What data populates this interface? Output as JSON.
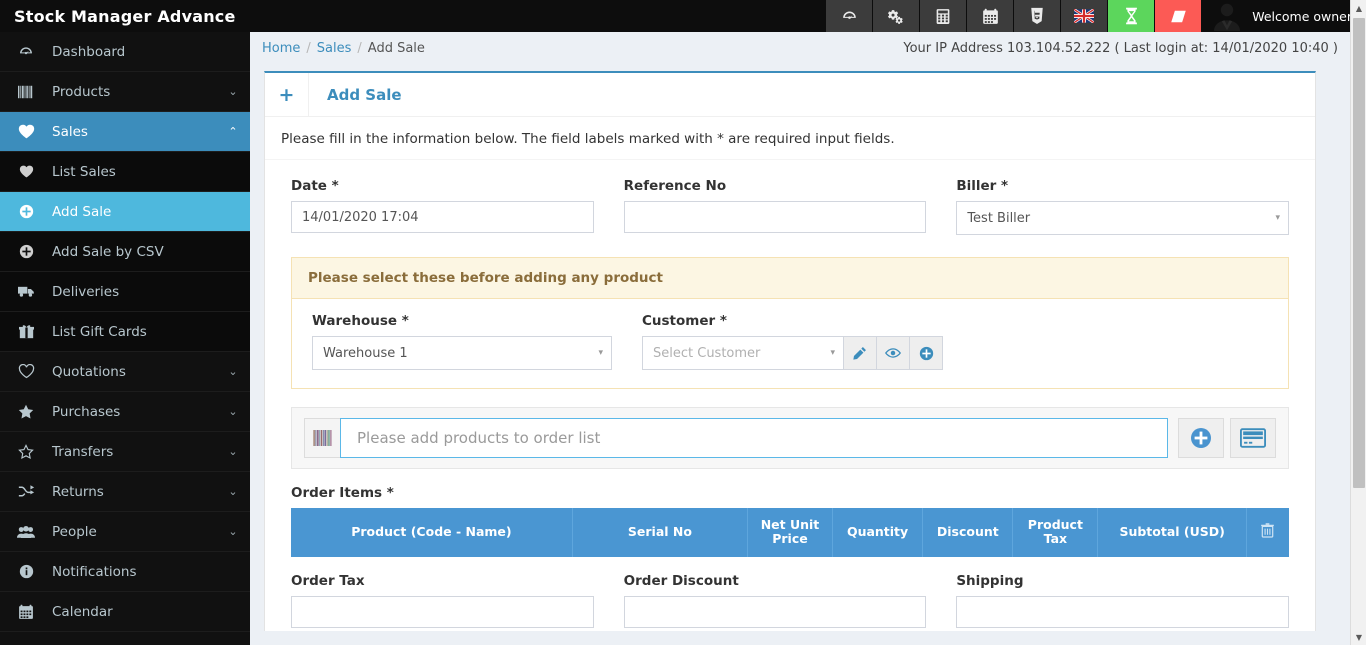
{
  "app": {
    "brand": "Stock Manager Advance",
    "user_greeting": "Welcome owner"
  },
  "topbar": {
    "icons": [
      {
        "name": "dashboard-icon",
        "glyph": "⚙",
        "style": "dark"
      },
      {
        "name": "settings-gears-icon",
        "glyph": "⚙",
        "style": "dark"
      },
      {
        "name": "calculator-icon",
        "glyph": "὚9",
        "style": "dark"
      },
      {
        "name": "calendar-icon",
        "glyph": "Ὄ5",
        "style": "dark"
      },
      {
        "name": "css3-icon",
        "glyph": "Ⓒ",
        "style": "dark"
      },
      {
        "name": "language-flag-icon",
        "glyph": "἞C",
        "style": "dark"
      },
      {
        "name": "hourglass-icon",
        "glyph": "⌛",
        "style": "green"
      },
      {
        "name": "eraser-icon",
        "glyph": "▱",
        "style": "red"
      }
    ],
    "colors": {
      "green": "#5cd65c",
      "red": "#fc5a55",
      "dark": "#3c3c3c"
    }
  },
  "sidebar": {
    "items": [
      {
        "label": "Dashboard",
        "icon": "dashboard-icon",
        "caret": "",
        "state": ""
      },
      {
        "label": "Products",
        "icon": "barcode-icon",
        "caret": "⌄",
        "state": ""
      },
      {
        "label": "Sales",
        "icon": "heart-filled-icon",
        "caret": "⌃",
        "state": "active-parent"
      },
      {
        "label": "List Sales",
        "icon": "heart-filled-icon",
        "caret": "",
        "state": "sub"
      },
      {
        "label": "Add Sale",
        "icon": "plus-circle-icon",
        "caret": "",
        "state": "active-child"
      },
      {
        "label": "Add Sale by CSV",
        "icon": "plus-circle-icon",
        "caret": "",
        "state": "sub"
      },
      {
        "label": "Deliveries",
        "icon": "truck-icon",
        "caret": "",
        "state": "sub"
      },
      {
        "label": "List Gift Cards",
        "icon": "gift-icon",
        "caret": "",
        "state": "sub"
      },
      {
        "label": "Quotations",
        "icon": "heart-outline-icon",
        "caret": "⌄",
        "state": ""
      },
      {
        "label": "Purchases",
        "icon": "star-filled-icon",
        "caret": "⌄",
        "state": ""
      },
      {
        "label": "Transfers",
        "icon": "star-outline-icon",
        "caret": "⌄",
        "state": ""
      },
      {
        "label": "Returns",
        "icon": "shuffle-icon",
        "caret": "⌄",
        "state": ""
      },
      {
        "label": "People",
        "icon": "users-icon",
        "caret": "⌄",
        "state": ""
      },
      {
        "label": "Notifications",
        "icon": "info-circle-icon",
        "caret": "",
        "state": ""
      },
      {
        "label": "Calendar",
        "icon": "calendar-icon",
        "caret": "",
        "state": ""
      }
    ]
  },
  "breadcrumb": {
    "home": "Home",
    "section": "Sales",
    "current": "Add Sale",
    "separator": "/"
  },
  "ip_info": "Your IP Address 103.104.52.222 ( Last login at: 14/01/2020 10:40 )",
  "panel": {
    "plus": "+",
    "title": "Add Sale",
    "subtitle": "Please fill in the information below. The field labels marked with * are required input fields."
  },
  "form": {
    "date": {
      "label": "Date *",
      "value": "14/01/2020 17:04"
    },
    "reference_no": {
      "label": "Reference No",
      "value": "",
      "placeholder": ""
    },
    "biller": {
      "label": "Biller *",
      "value": "Test Biller",
      "arrow": "▾"
    }
  },
  "callout": {
    "heading": "Please select these before adding any product",
    "warehouse": {
      "label": "Warehouse *",
      "value": "Warehouse 1",
      "arrow": "▾"
    },
    "customer": {
      "label": "Customer *",
      "value": "Select Customer",
      "arrow": "▾",
      "buttons": [
        {
          "name": "edit-customer-button",
          "glyph": "✎"
        },
        {
          "name": "view-customer-button",
          "glyph": "◉"
        },
        {
          "name": "add-customer-button",
          "glyph": "⊕"
        }
      ]
    }
  },
  "product_search": {
    "barcode_icon": "barcode-icon",
    "placeholder": "Please add products to order list",
    "value": "",
    "buttons": [
      {
        "name": "add-product-button",
        "glyph": "⊕"
      },
      {
        "name": "gift-card-button",
        "glyph": "▭"
      }
    ]
  },
  "order_items": {
    "label": "Order Items *",
    "columns": [
      "Product (Code - Name)",
      "Serial No",
      "Net Unit Price",
      "Quantity",
      "Discount",
      "Product Tax",
      "Subtotal (USD)"
    ],
    "delete_icon": "trash-icon",
    "rows": []
  },
  "totals": {
    "order_tax": {
      "label": "Order Tax",
      "value": ""
    },
    "order_discount": {
      "label": "Order Discount",
      "value": ""
    },
    "shipping": {
      "label": "Shipping",
      "value": ""
    }
  },
  "scrollbar": {
    "up": "▲",
    "down": "▼"
  },
  "colors": {
    "accent": "#3c8dbc",
    "active_child": "#4eb8dd",
    "table_header": "#4a96d2",
    "warning_bg": "#fcf6e3",
    "warning_text": "#8a6d3b",
    "page_bg": "#ecf0f5"
  }
}
